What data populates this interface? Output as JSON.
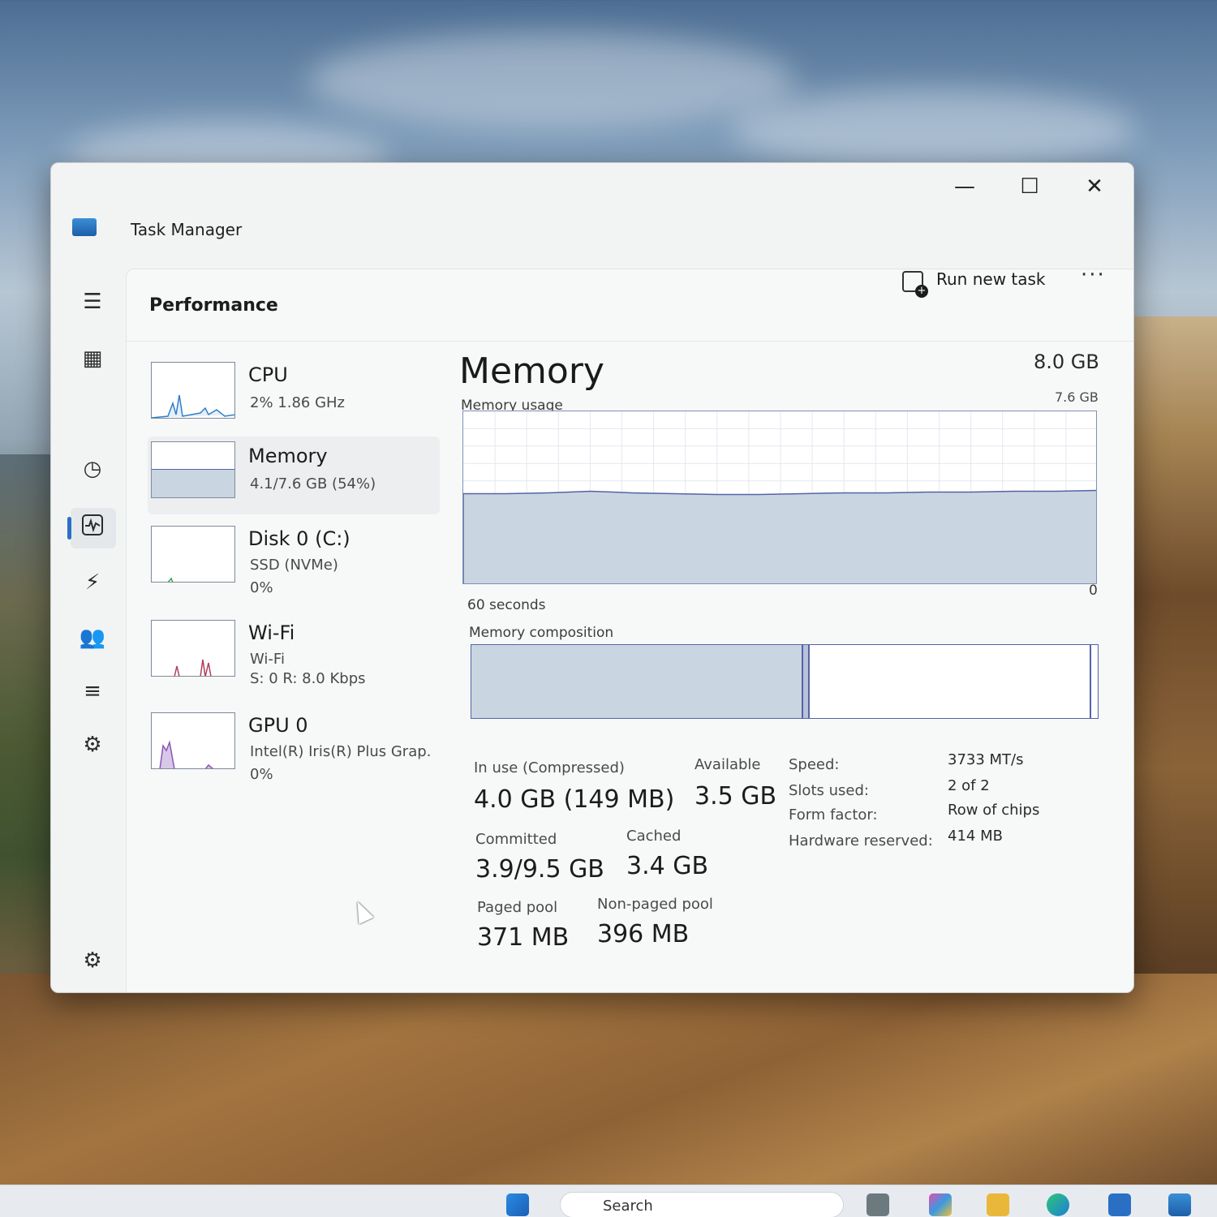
{
  "window": {
    "title": "Task Manager",
    "controls": {
      "minimize": "—",
      "maximize": "☐",
      "close": "✕"
    }
  },
  "toolbar": {
    "page_title": "Performance",
    "run_new_task": "Run new task",
    "more": "···"
  },
  "nav": [
    "menu-icon",
    "processes-icon",
    "performance-icon",
    "app-history-icon",
    "startup-apps-icon",
    "users-icon",
    "details-icon",
    "services-icon",
    "settings-icon"
  ],
  "devices": [
    {
      "name": "CPU",
      "line1": "2%  1.86 GHz",
      "line2": ""
    },
    {
      "name": "Memory",
      "line1": "4.1/7.6 GB (54%)",
      "line2": ""
    },
    {
      "name": "Disk 0 (C:)",
      "line1": "SSD (NVMe)",
      "line2": "0%"
    },
    {
      "name": "Wi-Fi",
      "line1": "Wi-Fi",
      "line2": "S: 0  R: 8.0 Kbps"
    },
    {
      "name": "GPU 0",
      "line1": "Intel(R) Iris(R) Plus Grap.",
      "line2": "0%"
    }
  ],
  "memory": {
    "title": "Memory",
    "total": "8.0 GB",
    "usage_label": "Memory usage",
    "usage_max": "7.6 GB",
    "time_span": "60 seconds",
    "min_label": "0",
    "usage_fraction": 0.54,
    "composition_label": "Memory composition",
    "composition": {
      "in_use_fraction": 0.53,
      "modified_fraction": 0.01,
      "standby_fraction": 0.44
    },
    "stats": {
      "in_use_label": "In use (Compressed)",
      "in_use_value": "4.0 GB (149 MB)",
      "available_label": "Available",
      "available_value": "3.5 GB",
      "committed_label": "Committed",
      "committed_value": "3.9/9.5 GB",
      "cached_label": "Cached",
      "cached_value": "3.4 GB",
      "paged_label": "Paged pool",
      "paged_value": "371 MB",
      "nonpaged_label": "Non-paged pool",
      "nonpaged_value": "396 MB"
    },
    "hardware": [
      {
        "key": "Speed:",
        "value": "3733 MT/s"
      },
      {
        "key": "Slots used:",
        "value": "2 of 2"
      },
      {
        "key": "Form factor:",
        "value": "Row of chips"
      },
      {
        "key": "Hardware reserved:",
        "value": "414 MB"
      }
    ]
  },
  "taskbar": {
    "search_placeholder": "Search"
  },
  "colors": {
    "accent": "#2c6fc4",
    "memory_fill": "#c9d6e2",
    "memory_line": "#5563a8"
  }
}
